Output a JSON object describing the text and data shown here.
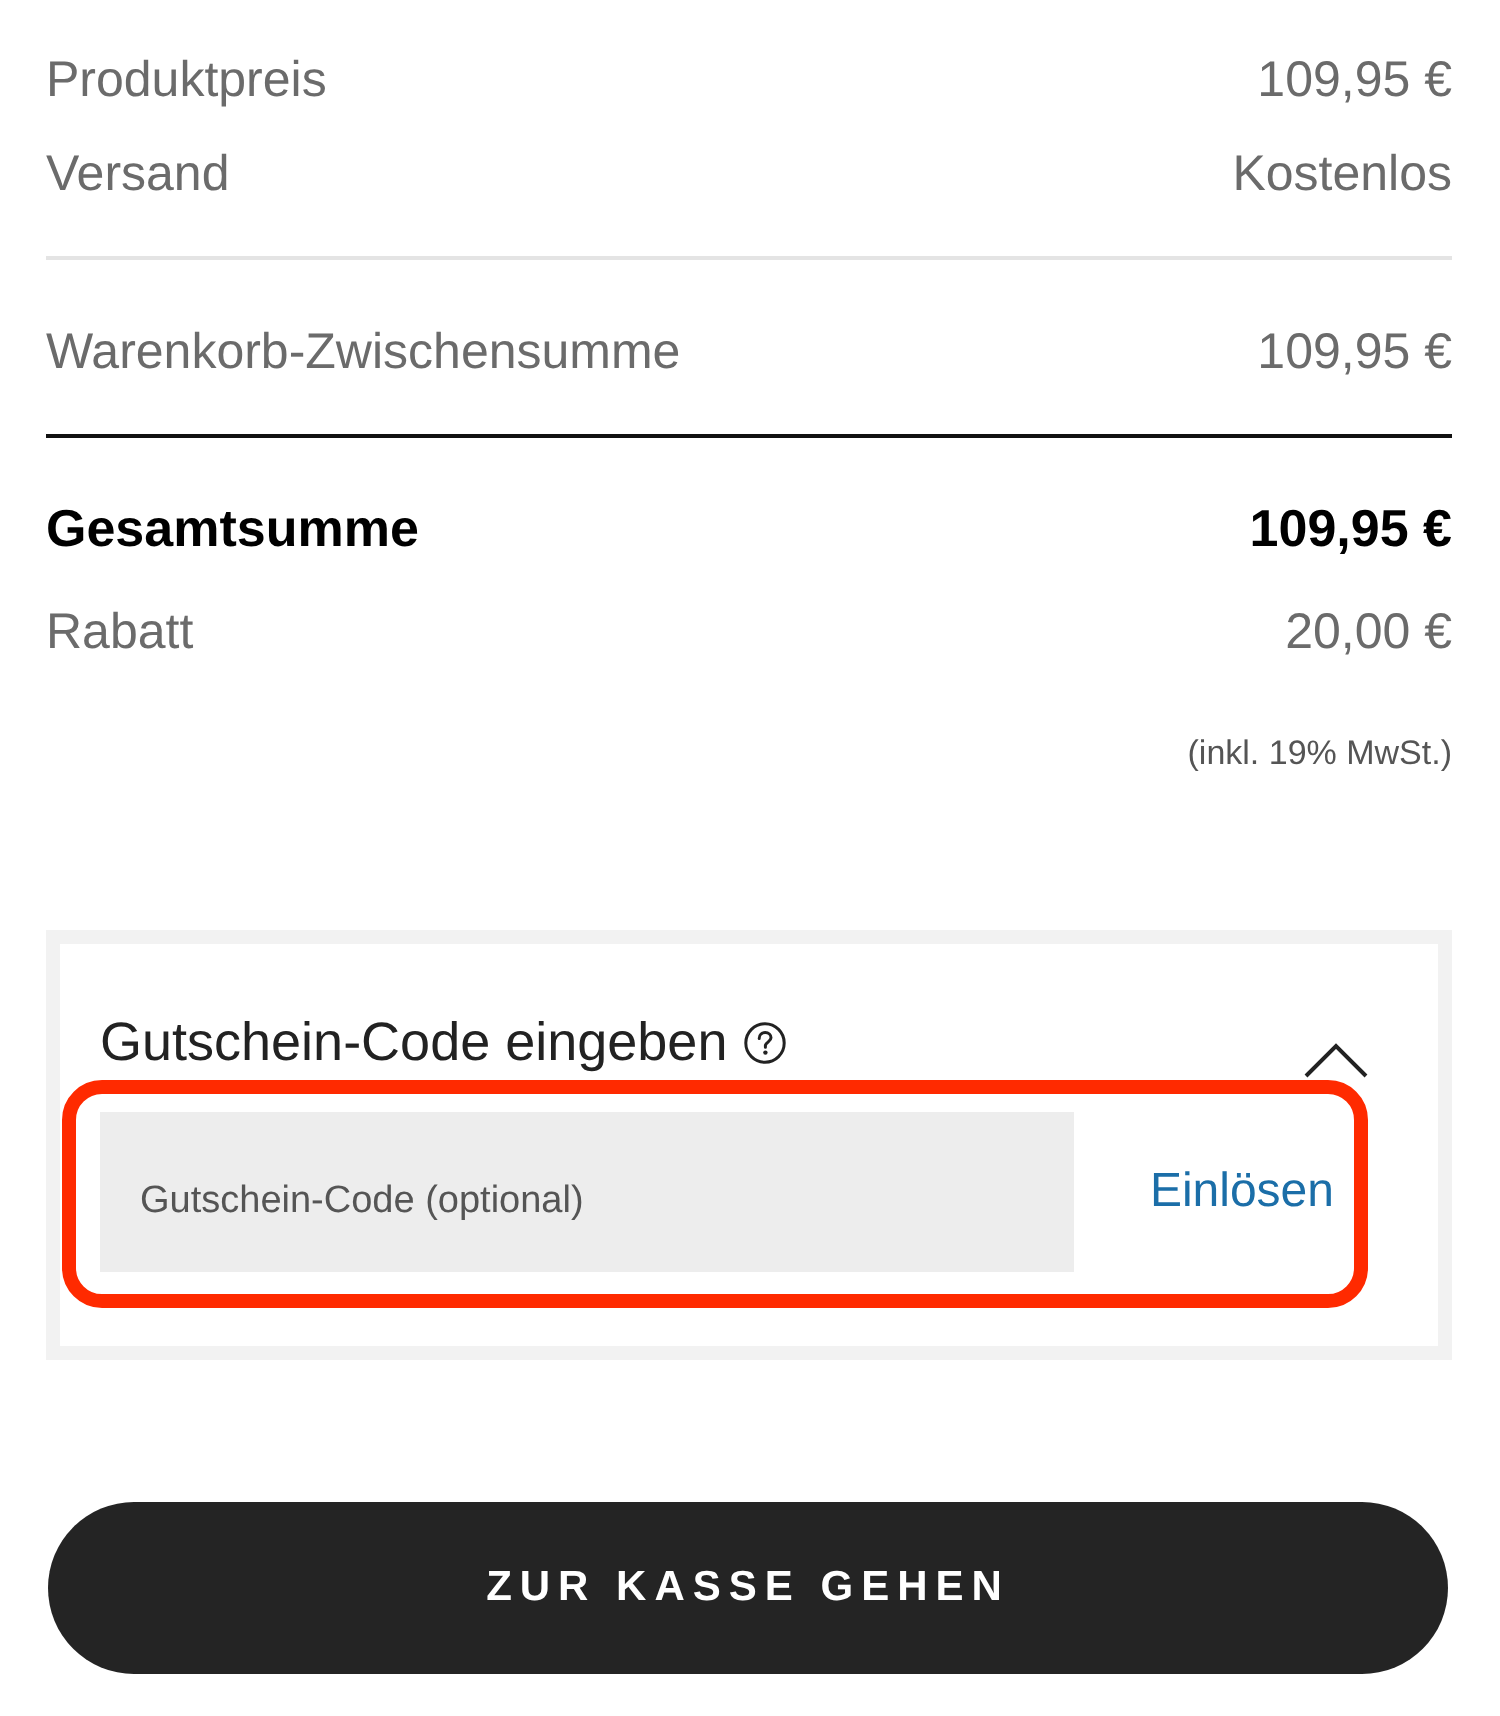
{
  "summary_lines": [
    {
      "label": "Produktpreis",
      "value": "109,95 €"
    },
    {
      "label": "Versand",
      "value": "Kostenlos"
    }
  ],
  "subtotal": {
    "label": "Warenkorb-Zwischensumme",
    "value": "109,95 €"
  },
  "total": {
    "label": "Gesamtsumme",
    "value": "109,95 €"
  },
  "discount": {
    "label": "Rabatt",
    "value": "20,00 €"
  },
  "tax_note": "(inkl. 19% MwSt.)",
  "coupon": {
    "title": "Gutschein-Code eingeben",
    "expanded": true,
    "highlighted": true,
    "input": {
      "placeholder": "Gutschein-Code (optional)"
    },
    "redeem_link": "Einlösen"
  },
  "checkout_button": "ZUR KASSE GEHEN"
}
